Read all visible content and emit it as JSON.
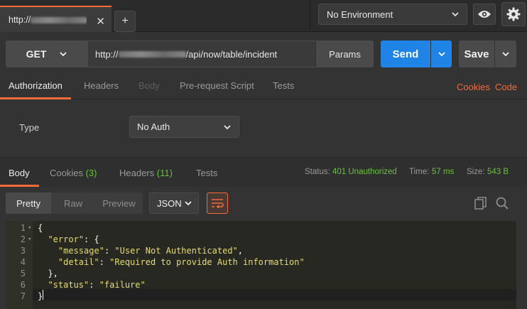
{
  "window": {
    "tab": {
      "label_prefix": "http://",
      "close": "✕"
    },
    "add_tab": "+"
  },
  "environment": {
    "selected": "No Environment"
  },
  "request": {
    "method": "GET",
    "url_prefix": "http://",
    "url_suffix": "/api/now/table/incident",
    "params_label": "Params",
    "send_label": "Send",
    "save_label": "Save"
  },
  "request_tabs": [
    {
      "label": "Authorization",
      "state": "active"
    },
    {
      "label": "Headers",
      "state": "normal"
    },
    {
      "label": "Body",
      "state": "disabled"
    },
    {
      "label": "Pre-request Script",
      "state": "normal"
    },
    {
      "label": "Tests",
      "state": "normal"
    }
  ],
  "links": {
    "cookies": "Cookies",
    "code": "Code"
  },
  "auth": {
    "type_label": "Type",
    "selected": "No Auth"
  },
  "response_tabs": [
    {
      "label": "Body",
      "count": ""
    },
    {
      "label": "Cookies",
      "count": "(3)"
    },
    {
      "label": "Headers",
      "count": "(11)"
    },
    {
      "label": "Tests",
      "count": ""
    }
  ],
  "response_stats": {
    "status_label": "Status:",
    "status_value": "401 Unauthorized",
    "time_label": "Time:",
    "time_value": "57 ms",
    "size_label": "Size:",
    "size_value": "543 B"
  },
  "format": {
    "modes": [
      "Pretty",
      "Raw",
      "Preview"
    ],
    "language": "JSON"
  },
  "code_lines": [
    {
      "n": "1",
      "fold": "▾"
    },
    {
      "n": "2",
      "fold": "▾"
    },
    {
      "n": "3",
      "fold": ""
    },
    {
      "n": "4",
      "fold": ""
    },
    {
      "n": "5",
      "fold": ""
    },
    {
      "n": "6",
      "fold": ""
    },
    {
      "n": "7",
      "fold": ""
    }
  ],
  "json_body": {
    "error_key": "\"error\"",
    "message_key": "\"message\"",
    "message_val": "\"User Not Authenticated\"",
    "detail_key": "\"detail\"",
    "detail_val": "\"Required to provide Auth information\"",
    "status_key": "\"status\"",
    "status_val": "\"failure\""
  },
  "colors": {
    "accent": "#f26b3a",
    "send": "#1f84e6",
    "success": "#67c23a"
  }
}
